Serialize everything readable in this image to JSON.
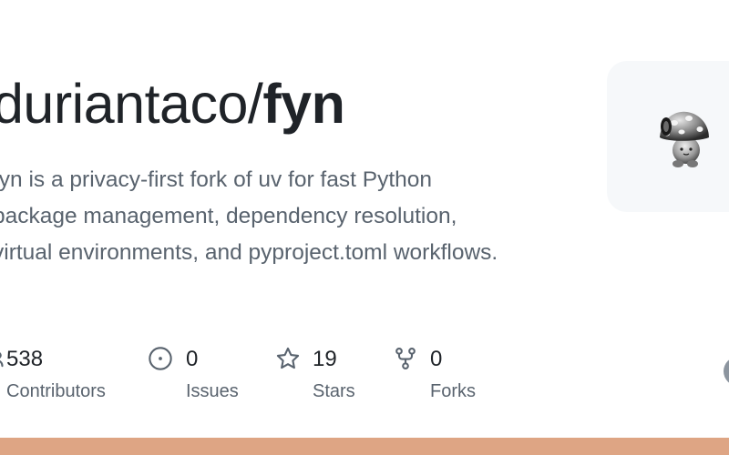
{
  "repo": {
    "owner": "duriantaco",
    "separator": "/",
    "name": "fyn"
  },
  "description": [
    "fyn is a privacy-first fork of uv for fast Python",
    "package management, dependency resolution,",
    "virtual environments, and pyproject.toml workflows."
  ],
  "stats": [
    {
      "icon": "people-icon",
      "value": "538",
      "label": "Contributors"
    },
    {
      "icon": "issue-icon",
      "value": "0",
      "label": "Issues"
    },
    {
      "icon": "star-icon",
      "value": "19",
      "label": "Stars"
    },
    {
      "icon": "fork-icon",
      "value": "0",
      "label": "Forks"
    }
  ],
  "avatar": {
    "icon": "mushroom-charm-icon"
  },
  "colors": {
    "text_primary": "#1f2328",
    "text_secondary": "#59636e",
    "avatar_bg": "#f6f8fa",
    "bottom_bar": "#dea584",
    "side_circle": "#8c959f"
  }
}
